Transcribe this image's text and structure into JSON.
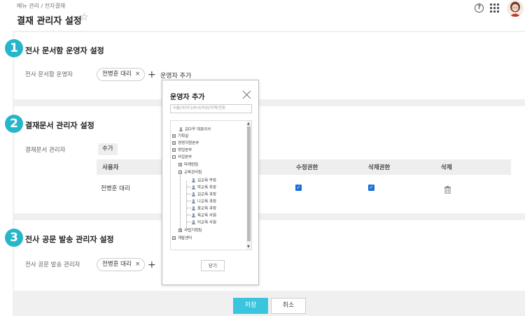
{
  "header": {
    "breadcrumb": "메뉴 관리 / 전자결재",
    "title": "결재 관리자 설정",
    "star_icon": "star-outline-icon",
    "help_icon": "question-circle-icon",
    "apps_icon": "grid-apps-icon"
  },
  "section1": {
    "number": "1",
    "title": "전사 문서함 운영자 설정",
    "label": "전사 문서함 운영자",
    "chip": "전병훈 대리",
    "chip_remove": "×",
    "plus": "+",
    "add_label": "운영자 추가"
  },
  "section2": {
    "number": "2",
    "title": "결재문서 관리자 설정",
    "label": "결재문서 관리자",
    "add_button": "추가",
    "columns": [
      "사용자",
      "수정권한",
      "삭제권한",
      "삭제"
    ],
    "rows": [
      {
        "user": "전병훈 대리",
        "edit": true,
        "delete_perm": true
      }
    ]
  },
  "section3": {
    "number": "3",
    "title": "전사 공문 발송 관리자 설정",
    "label": "전사 공문 발송 관리자",
    "chip": "전병훈 대리",
    "chip_remove": "×",
    "plus": "+"
  },
  "footer": {
    "save": "저장",
    "cancel": "취소"
  },
  "modal": {
    "title": "운영자 추가",
    "search_placeholder": "이름/아이디/부서/직위/직책/전화",
    "close_button": "닫기",
    "tree": [
      {
        "label": "김다우 대표이사",
        "kind": "person"
      },
      {
        "label": "기획실",
        "kind": "folder",
        "expander": "+"
      },
      {
        "label": "경영지원본부",
        "kind": "folder",
        "expander": "+"
      },
      {
        "label": "영업본부",
        "kind": "folder",
        "expander": "+"
      },
      {
        "label": "사업본부",
        "kind": "folder",
        "expander": "−"
      },
      {
        "label": "마케팅팀",
        "kind": "folder",
        "expander": "+"
      },
      {
        "label": "교육관리팀",
        "kind": "folder",
        "expander": "−"
      },
      {
        "label": "김교육 부장",
        "kind": "person"
      },
      {
        "label": "박교육 차장",
        "kind": "person"
      },
      {
        "label": "김교육 과장",
        "kind": "person"
      },
      {
        "label": "나교육 과장",
        "kind": "person"
      },
      {
        "label": "윤교육 과장",
        "kind": "person"
      },
      {
        "label": "육교육 사원",
        "kind": "person"
      },
      {
        "label": "이교육 사원",
        "kind": "person"
      },
      {
        "label": "사업기획팀",
        "kind": "folder",
        "expander": "+"
      },
      {
        "label": "개발센터",
        "kind": "folder",
        "expander": "+"
      }
    ]
  },
  "colors": {
    "accent": "#27b6c9",
    "save_button": "#3bc4dd",
    "checkbox": "#1a6fd6",
    "background": "#f0f0f0"
  }
}
